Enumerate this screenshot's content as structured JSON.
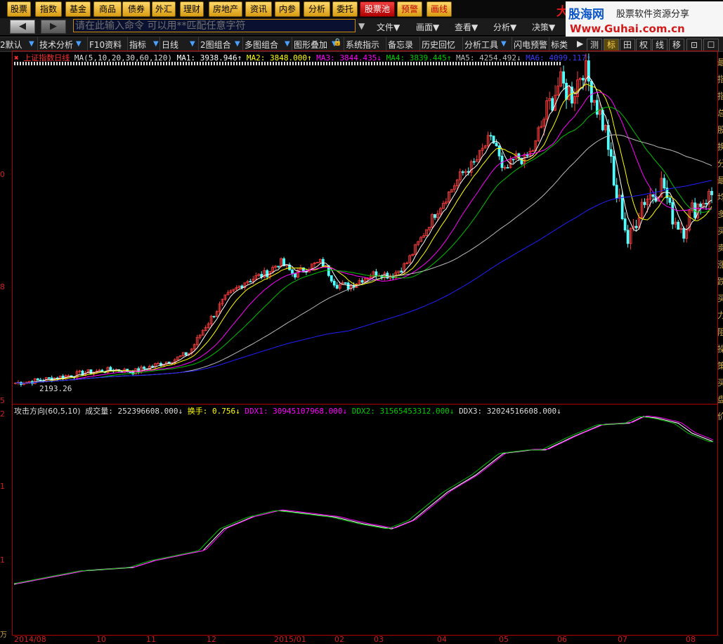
{
  "top_menu": [
    "股票",
    "指数",
    "基金",
    "商品",
    "债券",
    "外汇",
    "理财",
    "房地产",
    "资讯",
    "内参",
    "分析",
    "委托",
    "股票池",
    "预警",
    "画线"
  ],
  "top_menu_red": [
    "股票池",
    "预警",
    "画线"
  ],
  "brand": {
    "da": "大",
    "site": "股海网",
    "slogan": "股票软件资源分享",
    "url": "Www.Guhai.com.cn"
  },
  "command": {
    "placeholder": "请在此输入命令   可以用**匹配任意字符",
    "back_glyph": "◀",
    "forward_glyph": "▶"
  },
  "menus": [
    "文件▼",
    "画面▼",
    "查看▼",
    "分析▼",
    "决策▼"
  ],
  "toolbar": {
    "items": [
      "2默认",
      "技术分析",
      "F10资料",
      "指标",
      "日线",
      "2图组合",
      "多图组合",
      "图形叠加",
      "系统指示",
      "备忘录",
      "历史回忆",
      "分析工具",
      "闪电预警",
      "标类"
    ],
    "right_buttons": [
      "测",
      "标",
      "田",
      "权",
      "线",
      "移"
    ]
  },
  "main_legend": {
    "title": "上证指数日线",
    "ma_params": "MA(5,10,20,30,60,120)",
    "ma1": "MA1: 3938.946↑",
    "ma2": "MA2: 3848.000↑",
    "ma3": "MA3: 3844.435↓",
    "ma4": "MA4: 3839.445↑",
    "ma5": "MA5: 4254.492↓",
    "ma6": "MA6: 4099.117↑",
    "low_label": "2193.26"
  },
  "sub_legend": {
    "name": "攻击方向(60,5,10)",
    "vol": "成交量: 252396608.000↓",
    "turnover": "换手: 0.756↓",
    "ddx1": "DDX1: 30945107968.000↓",
    "ddx2": "DDX2: 31565453312.000↓",
    "ddx3": "DDX3: 32024516608.000↓"
  },
  "yaxis_main": [
    "0",
    "8",
    "5"
  ],
  "yaxis_sub": [
    "2",
    "1",
    "1",
    "万"
  ],
  "dates": [
    "2014/08",
    "10",
    "11",
    "12",
    "2015/01",
    "02",
    "03",
    "04",
    "05",
    "06",
    "07",
    "08"
  ],
  "right_column_chars": [
    "最",
    "指",
    "指",
    "总",
    "股",
    "换",
    "分",
    "最",
    "均",
    "多",
    "买",
    "卖",
    "涨",
    "跌",
    "买",
    "力",
    "阻",
    "操",
    "策",
    "买",
    "盘",
    "价"
  ],
  "colors": {
    "up": "#ff3c3c",
    "down": "#54ffff",
    "ma1": "#ffffff",
    "ma2": "#ffff00",
    "ma3": "#ff00ff",
    "ma4": "#00c000",
    "ma5": "#bbbbbb",
    "ma6": "#2020ff"
  },
  "chart_data": {
    "type": "line",
    "title": "上证指数日线",
    "x": [
      "2014/08",
      "10",
      "11",
      "12",
      "2015/01",
      "02",
      "03",
      "04",
      "05",
      "06",
      "07",
      "08"
    ],
    "series": [
      {
        "name": "MA1",
        "values": [
          2205,
          2340,
          2450,
          2950,
          3250,
          3230,
          3600,
          4200,
          4500,
          4900,
          3900,
          3940
        ]
      },
      {
        "name": "MA6",
        "values": [
          2150,
          2210,
          2280,
          2420,
          2650,
          2900,
          3150,
          3450,
          3750,
          4050,
          4080,
          4099
        ]
      }
    ]
  }
}
